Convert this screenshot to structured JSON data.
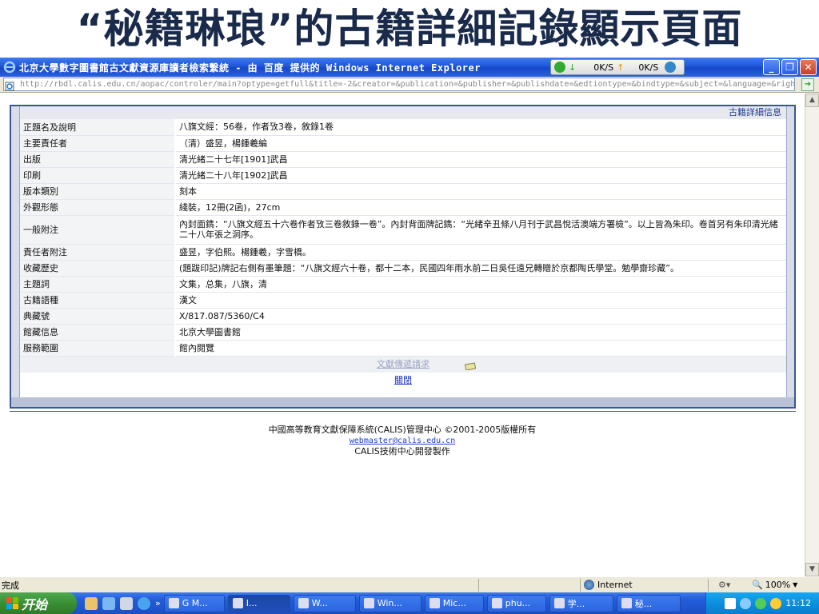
{
  "slide": {
    "title": "“秘籍琳琅”的古籍詳細記錄顯示頁面"
  },
  "window": {
    "title": "北京大學數字圖書館古文獻資源庫讀者檢索繫統 - 由 百度 提供的 Windows Internet Explorer",
    "download_speed": "0K/S",
    "upload_speed": "0K/S"
  },
  "address": {
    "url": "http://rbdl.calis.edu.cn/aopac/controler/main?optype=getfull&title=-2&creator=&publication=&publisher=&publishdate=&edtiontype=&bindtype=&subject=&language=&right"
  },
  "detail": {
    "header": "古籍詳細信息",
    "rows": [
      {
        "label": "正題名及說明",
        "value": "八旗文經：56卷，作者攷3卷，敘錄1卷"
      },
      {
        "label": "主要責任者",
        "value": "（清）盛昱，楊鍾羲編"
      },
      {
        "label": "出版",
        "value": "清光緒二十七年[1901]武昌"
      },
      {
        "label": "印刷",
        "value": "清光緒二十八年[1902]武昌"
      },
      {
        "label": "版本類別",
        "value": "刻本"
      },
      {
        "label": "外觀形態",
        "value": "綫裝，12冊(2函)，27cm"
      },
      {
        "label": "一般附注",
        "value": "內封面鐫：“八旗文經五十六卷作者攷三卷敘錄一卷”。內封背面牌記鐫：“光緒辛丑條八月刊于武昌悅活澳端方署檢”。以上皆為朱印。卷首另有朱印清光緒二十八年張之洞序。"
      },
      {
        "label": "責任者附注",
        "value": "盛昱，字伯熙。楊鍾羲，字雪橋。"
      },
      {
        "label": "收藏歷史",
        "value": "(題跋印記)牌記右側有墨筆題：“八旗文經六十卷，都十二本，民國四年雨水前二日吳任遠兄轉贈於京都陶氏學堂。勉學齋珍藏”。"
      },
      {
        "label": "主題詞",
        "value": "文集，总集，八旗，清"
      },
      {
        "label": "古籍語種",
        "value": "漢文"
      },
      {
        "label": "典藏號",
        "value": "X/817.087/5360/C4"
      },
      {
        "label": "館藏信息",
        "value": "北京大學圖書館"
      },
      {
        "label": "服務範圍",
        "value": "館內閱覽"
      }
    ],
    "request_link": "文獻傳遞請求",
    "close_link": "關閉"
  },
  "footer": {
    "line1": "中國高等教育文獻保障系統(CALIS)管理中心  ©2001-2005版權所有",
    "email": "webmaster@calis.edu.cn",
    "line3": "CALIS技術中心開發製作"
  },
  "status": {
    "text": "完成",
    "zone": "Internet",
    "zoom": "100%"
  },
  "taskbar": {
    "start": "开始",
    "tasks": [
      "G M...",
      "I...",
      "W...",
      "Win...",
      "Mic...",
      "phu...",
      "学...",
      "秘..."
    ],
    "clock": "11:12"
  }
}
